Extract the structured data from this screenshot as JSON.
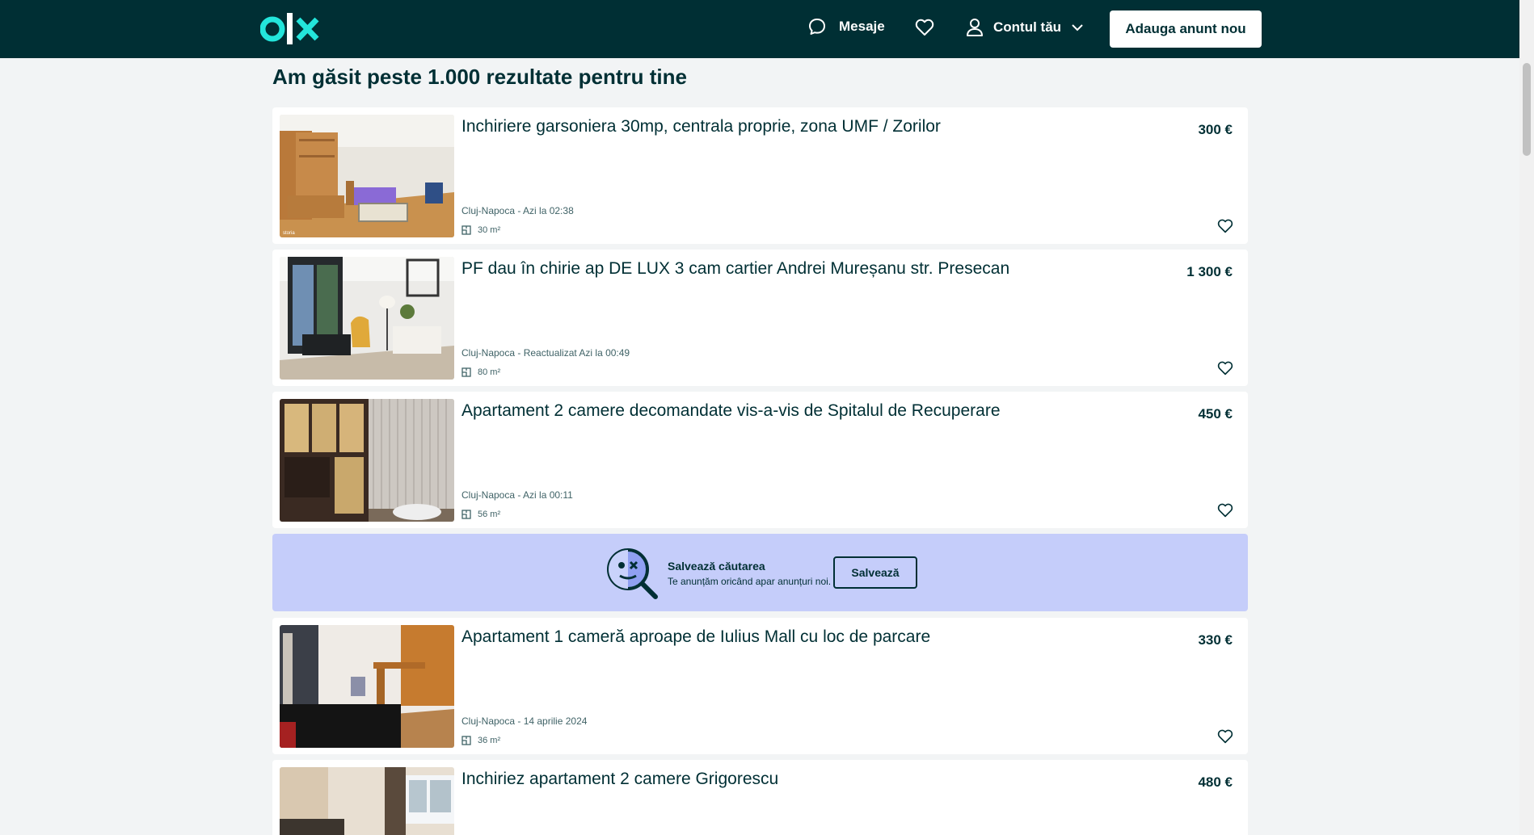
{
  "header": {
    "messages_label": "Mesaje",
    "account_label": "Contul tău",
    "post_button": "Adauga anunt nou"
  },
  "results_title": "Am găsit peste 1.000 rezultate pentru tine",
  "listings": [
    {
      "title": "Inchiriere garsoniera 30mp, centrala proprie, zona UMF / Zorilor",
      "price": "300 €",
      "meta": "Cluj-Napoca - Azi la 02:38",
      "area": "30 m²",
      "watermark": "storia"
    },
    {
      "title": "PF dau în chirie ap DE LUX 3 cam cartier Andrei Mureșanu str. Presecan",
      "price": "1 300 €",
      "meta": "Cluj-Napoca - Reactualizat Azi la 00:49",
      "area": "80 m²"
    },
    {
      "title": "Apartament 2 camere decomandate vis-a-vis de Spitalul de Recuperare",
      "price": "450 €",
      "meta": "Cluj-Napoca - Azi la 00:11",
      "area": "56 m²"
    },
    {
      "title": "Apartament 1 cameră aproape de Iulius Mall cu loc de parcare",
      "price": "330 €",
      "meta": "Cluj-Napoca - 14 aprilie 2024",
      "area": "36 m²"
    },
    {
      "title": "Inchiriez apartament 2 camere Grigorescu",
      "price": "480 €"
    }
  ],
  "save_search": {
    "title": "Salvează căutarea",
    "subtitle": "Te anunțăm oricând apar anunțuri noi.",
    "button": "Salvează"
  },
  "colors": {
    "header_bg": "#002f34",
    "accent_teal": "#23e5db",
    "save_banner_bg": "#c5cdfa"
  }
}
